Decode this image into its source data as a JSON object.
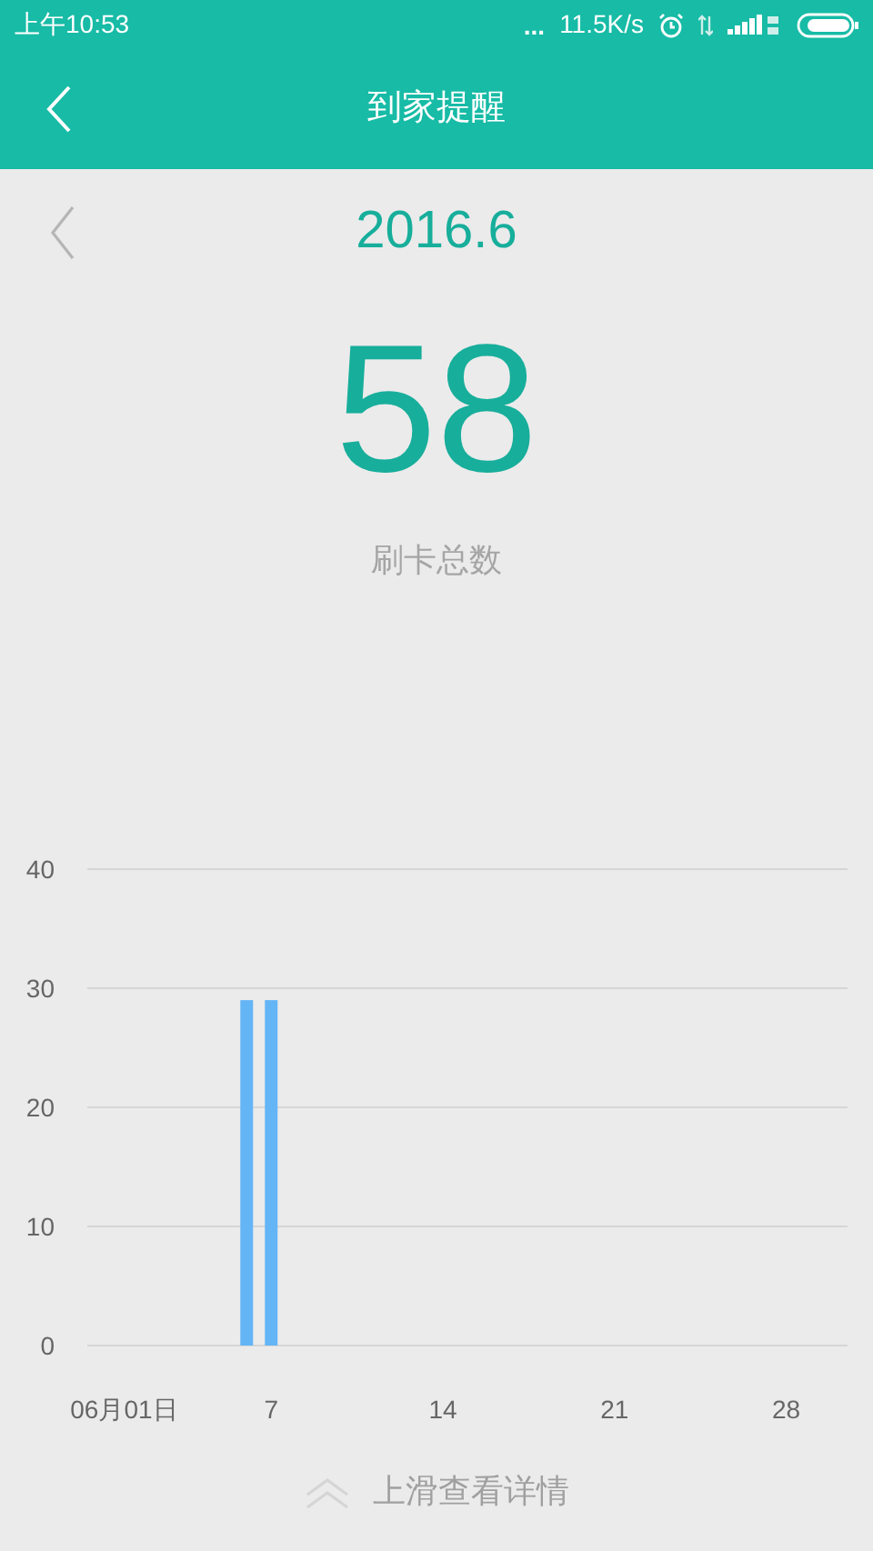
{
  "status_bar": {
    "time": "上午10:53",
    "dots": "...",
    "speed": "11.5K/s"
  },
  "header": {
    "title": "到家提醒"
  },
  "month_nav": {
    "month": "2016.6"
  },
  "summary": {
    "total": "58",
    "label": "刷卡总数"
  },
  "chart": {
    "chart_data": {
      "type": "bar",
      "grid": true,
      "x": [
        1,
        2,
        3,
        4,
        5,
        6,
        7,
        8,
        9,
        10,
        11,
        12,
        13,
        14,
        15,
        16,
        17,
        18,
        19,
        20,
        21,
        22,
        23,
        24,
        25,
        26,
        27,
        28,
        29,
        30
      ],
      "xlim": [
        -0.5,
        30.5
      ],
      "series": [
        {
          "color": "#64b5f6",
          "values": [
            0,
            0,
            0,
            0,
            0,
            29,
            29,
            0,
            0,
            0,
            0,
            0,
            0,
            0,
            0,
            0,
            0,
            0,
            0,
            0,
            0,
            0,
            0,
            0,
            0,
            0,
            0,
            0,
            0,
            0
          ]
        }
      ],
      "ylim": [
        0,
        40
      ],
      "yticks": [
        0,
        10,
        20,
        30,
        40
      ],
      "xticks": [
        {
          "value": 1,
          "label": "06月01日"
        },
        {
          "value": 7,
          "label": "7"
        },
        {
          "value": 14,
          "label": "14"
        },
        {
          "value": 21,
          "label": "21"
        },
        {
          "value": 28,
          "label": "28"
        }
      ]
    }
  },
  "footer": {
    "hint": "上滑查看详情"
  }
}
